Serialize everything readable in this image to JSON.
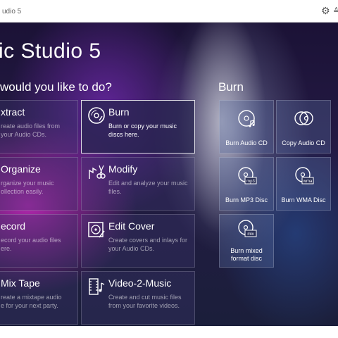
{
  "window": {
    "title": "udio 5"
  },
  "app": {
    "title": "ic Studio 5"
  },
  "sections": {
    "main_title": "would you like to do?",
    "burn_title": "Burn"
  },
  "tiles": [
    {
      "title": "xtract",
      "desc": "reate audio files from\nyour Audio CDs.",
      "icon": "extract-icon"
    },
    {
      "title": "Burn",
      "desc": "Burn or copy your music discs here.",
      "icon": "burn-disc-icon"
    },
    {
      "title": "Organize",
      "desc": "rganize your music\nollection easily.",
      "icon": "organize-icon"
    },
    {
      "title": "Modify",
      "desc": "Edit and analyze your music files.",
      "icon": "modify-scissors-icon"
    },
    {
      "title": "ecord",
      "desc": "ecord your audio files\nere.",
      "icon": "record-icon"
    },
    {
      "title": "Edit Cover",
      "desc": "Create covers and inlays for your Audio CDs.",
      "icon": "edit-cover-icon"
    },
    {
      "title": "Mix Tape",
      "desc": "reate a mixtape audio\ne for your next party.",
      "icon": "mix-tape-icon"
    },
    {
      "title": "Video-2-Music",
      "desc": "Create and cut music files from your favorite videos.",
      "icon": "film-strip-icon"
    }
  ],
  "burn_tiles": [
    {
      "label": "Burn Audio CD",
      "icon": "audio-cd-icon"
    },
    {
      "label": "Copy Audio CD",
      "icon": "copy-cd-icon"
    },
    {
      "label": "Burn MP3 Disc",
      "icon": "mp3-disc-icon",
      "badge": "mp3"
    },
    {
      "label": "Burn WMA Disc",
      "icon": "wma-disc-icon",
      "badge": "wma"
    },
    {
      "label": "Burn mixed format disc",
      "icon": "mixed-disc-icon",
      "badge": "mix"
    }
  ],
  "colors": {
    "selected_border": "#ffffff",
    "tile_bg": "#3c376e",
    "accent_purple": "#c828be"
  }
}
